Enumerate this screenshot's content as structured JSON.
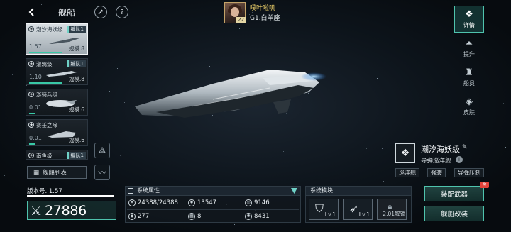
{
  "header": {
    "back_icon": "chevron-left-icon",
    "title": "舰船",
    "paint_icon": "brush-icon",
    "help_icon": "question-icon"
  },
  "commander": {
    "name": "噗叶啦叽",
    "level": "22",
    "location": "G1.白羊座"
  },
  "ship_list": [
    {
      "name": "潮汐海妖级",
      "fleet": "编队1",
      "version": "1.57",
      "scale": "规模.8",
      "active": true,
      "class_icon": "cruiser-icon"
    },
    {
      "name": "灌鸦级",
      "fleet": "编队1",
      "version": "1.10",
      "scale": "规模.8",
      "active": false,
      "class_icon": "cruiser-icon"
    },
    {
      "name": "游骑兵级",
      "fleet": "",
      "version": "0.01",
      "scale": "规模.6",
      "active": false,
      "class_icon": "cruiser-icon"
    },
    {
      "name": "赛壬之啼",
      "fleet": "",
      "version": "0.01",
      "scale": "规模.6",
      "active": false,
      "class_icon": "shield-icon"
    },
    {
      "name": "南鱼级",
      "fleet": "编队1",
      "version": "",
      "scale": "",
      "active": false,
      "class_icon": "cruiser-icon"
    }
  ],
  "ship_list_button": "舰船列表",
  "version": "版本号. 1.57",
  "power": "27886",
  "right_nav": [
    {
      "label": "详情",
      "icon": "ship-emblem-icon",
      "active": true
    },
    {
      "label": "提升",
      "icon": "upgrade-icon",
      "active": false
    },
    {
      "label": "船员",
      "icon": "crew-icon",
      "active": false
    },
    {
      "label": "皮肤",
      "icon": "skin-icon",
      "active": false
    }
  ],
  "ship_info": {
    "name": "潮汐海妖级",
    "type": "导弹巡洋舰",
    "tags": [
      "巡洋舰",
      "强袭",
      "导弹压制"
    ]
  },
  "system_attributes": {
    "title": "系统属性",
    "stats": [
      {
        "icon": "armor-icon",
        "value": "24388/24388"
      },
      {
        "icon": "firepower-icon",
        "value": "13547"
      },
      {
        "icon": "target-icon",
        "value": "9146"
      },
      {
        "icon": "shield-icon",
        "value": "277"
      },
      {
        "icon": "grid-icon",
        "value": "8"
      },
      {
        "icon": "speed-icon",
        "value": "8431"
      }
    ]
  },
  "system_modules": {
    "title": "系统模块",
    "modules": [
      {
        "icon": "shield-module-icon",
        "level": "Lv.1",
        "locked": false
      },
      {
        "icon": "missile-module-icon",
        "level": "Lv.1",
        "locked": false
      },
      {
        "icon": "lock-icon",
        "level": "2.01解锁",
        "locked": true
      }
    ]
  },
  "actions": {
    "equip_weapons": "装配武器",
    "ship_modify": "舰船改装",
    "new_badge": "新"
  }
}
